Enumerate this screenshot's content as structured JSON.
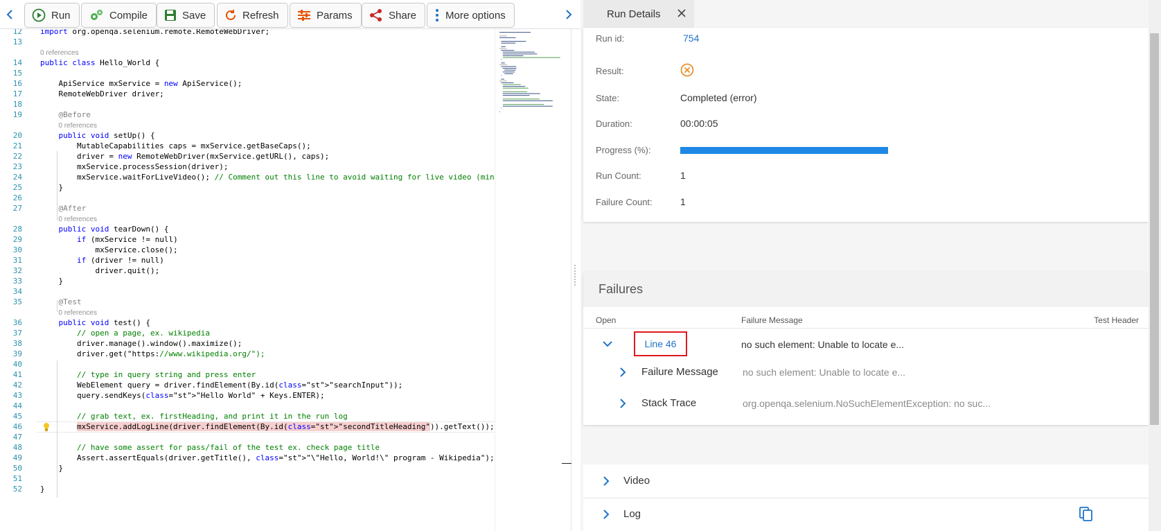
{
  "toolbar": {
    "run": "Run",
    "compile": "Compile",
    "save": "Save",
    "refresh": "Refresh",
    "params": "Params",
    "share": "Share",
    "more": "More options"
  },
  "editor": {
    "lines": [
      {
        "n": "12",
        "code": "import org.openqa.selenium.remote.RemoteWebDriver;"
      },
      {
        "n": "13",
        "code": ""
      },
      {
        "ref": "0 references"
      },
      {
        "n": "14",
        "code": "public class Hello_World {"
      },
      {
        "n": "15",
        "code": ""
      },
      {
        "n": "16",
        "code": "    ApiService mxService = new ApiService();"
      },
      {
        "n": "17",
        "code": "    RemoteWebDriver driver;"
      },
      {
        "n": "18",
        "code": ""
      },
      {
        "n": "19",
        "code": "    @Before"
      },
      {
        "ref": "0 references"
      },
      {
        "n": "20",
        "code": "    public void setUp() {"
      },
      {
        "n": "21",
        "code": "        MutableCapabilities caps = mxService.getBaseCaps();"
      },
      {
        "n": "22",
        "code": "        driver = new RemoteWebDriver(mxService.getURL(), caps);"
      },
      {
        "n": "23",
        "code": "        mxService.processSession(driver);"
      },
      {
        "n": "24",
        "code": "        mxService.waitForLiveVideo(); // Comment out this line to avoid waiting for live video (mini"
      },
      {
        "n": "25",
        "code": "    }"
      },
      {
        "n": "26",
        "code": ""
      },
      {
        "n": "27",
        "code": "    @After"
      },
      {
        "ref": "0 references"
      },
      {
        "n": "28",
        "code": "    public void tearDown() {"
      },
      {
        "n": "29",
        "code": "        if (mxService != null)"
      },
      {
        "n": "30",
        "code": "            mxService.close();"
      },
      {
        "n": "31",
        "code": "        if (driver != null)"
      },
      {
        "n": "32",
        "code": "            driver.quit();"
      },
      {
        "n": "33",
        "code": "    }"
      },
      {
        "n": "34",
        "code": ""
      },
      {
        "n": "35",
        "code": "    @Test"
      },
      {
        "ref": "0 references"
      },
      {
        "n": "36",
        "code": "    public void test() {"
      },
      {
        "n": "37",
        "code": "        // open a page, ex. wikipedia"
      },
      {
        "n": "38",
        "code": "        driver.manage().window().maximize();"
      },
      {
        "n": "39",
        "code": "        driver.get(\"https://www.wikipedia.org/\");"
      },
      {
        "n": "40",
        "code": ""
      },
      {
        "n": "41",
        "code": "        // type in query string and press enter"
      },
      {
        "n": "42",
        "code": "        WebElement query = driver.findElement(By.id(\"searchInput\"));"
      },
      {
        "n": "43",
        "code": "        query.sendKeys(\"Hello World\" + Keys.ENTER);"
      },
      {
        "n": "44",
        "code": ""
      },
      {
        "n": "45",
        "code": "        // grab text, ex. firstHeading, and print it in the run log"
      },
      {
        "n": "46",
        "code": "        mxService.addLogLine(driver.findElement(By.id(\"secondTitleHeading\")).getText());"
      },
      {
        "n": "47",
        "code": ""
      },
      {
        "n": "48",
        "code": "        // have some assert for pass/fail of the test ex. check page title"
      },
      {
        "n": "49",
        "code": "        Assert.assertEquals(driver.getTitle(), \"\\\"Hello, World!\\\" program - Wikipedia\");"
      },
      {
        "n": "50",
        "code": "    }"
      },
      {
        "n": "51",
        "code": ""
      },
      {
        "n": "52",
        "code": "}"
      }
    ]
  },
  "panel": {
    "tab_title": "Run Details",
    "details": {
      "run_id_label": "Run id:",
      "run_id": "754",
      "result_label": "Result:",
      "state_label": "State:",
      "state": "Completed (error)",
      "duration_label": "Duration:",
      "duration": "00:00:05",
      "progress_label": "Progress (%):",
      "progress_fraction": 1.0,
      "run_count_label": "Run Count:",
      "run_count": "1",
      "failure_count_label": "Failure Count:",
      "failure_count": "1"
    },
    "failures": {
      "title": "Failures",
      "col_open": "Open",
      "col_message": "Failure Message",
      "col_header": "Test Header",
      "row_link": "Line 46",
      "row_message": "no such element: Unable to locate e...",
      "sub_failure_label": "Failure Message",
      "sub_failure_value": "no such element: Unable to locate e...",
      "sub_stack_label": "Stack Trace",
      "sub_stack_value": "org.openqa.selenium.NoSuchElementException: no suc..."
    },
    "video_label": "Video",
    "log_label": "Log"
  },
  "colors": {
    "accent": "#1e88e5",
    "link": "#1e73c8",
    "error": "#e8912e",
    "highlight_border": "#e0191f"
  }
}
